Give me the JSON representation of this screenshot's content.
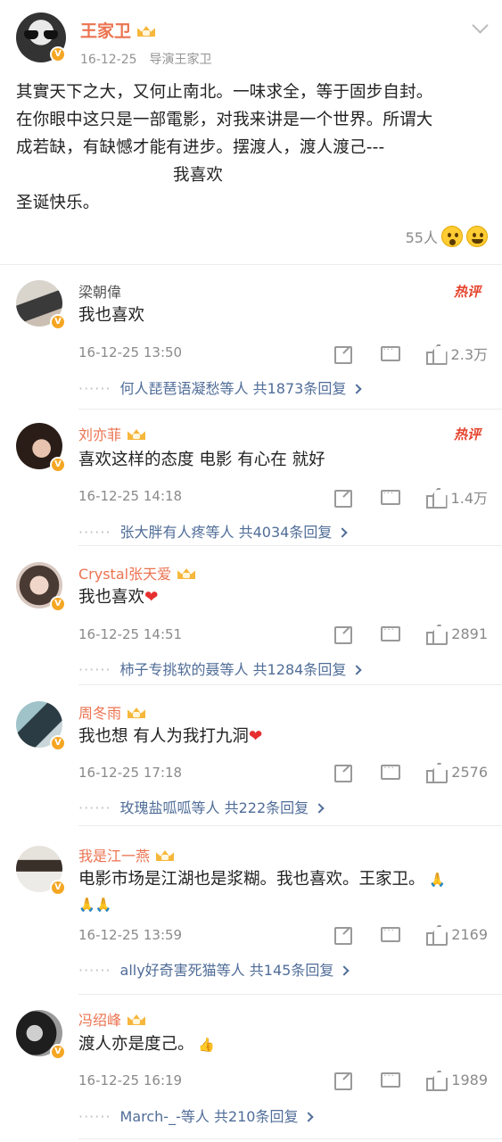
{
  "post": {
    "author": "王家卫",
    "date": "16-12-25",
    "source": "导演王家卫",
    "lines": [
      "其實天下之大，又何止南北。一味求全，等于固步自封。",
      "在你眼中这只是一部電影，对我来讲是一个世界。所谓大",
      "成若缺，有缺憾才能有进步。摆渡人，渡人渡己---",
      "我喜欢",
      "圣诞快乐。"
    ],
    "likes": "55人"
  },
  "comments": [
    {
      "name": "梁朝偉",
      "text": "我也喜欢",
      "time": "16-12-25 13:50",
      "hot": "热评",
      "likes": "2.3万",
      "reply_users": "何人琵琶语凝愁等人",
      "reply_count": "共1873条回复"
    },
    {
      "name": "刘亦菲",
      "text": "喜欢这样的态度 电影 有心在 就好",
      "time": "16-12-25 14:18",
      "hot": "热评",
      "likes": "1.4万",
      "reply_users": "张大胖有人疼等人",
      "reply_count": "共4034条回复"
    },
    {
      "name": "Crystal张天爱",
      "text": "我也喜欢",
      "time": "16-12-25 14:51",
      "hot": "",
      "likes": "2891",
      "reply_users": "柿子专挑软的聂等人",
      "reply_count": "共1284条回复"
    },
    {
      "name": "周冬雨",
      "text": "我也想 有人为我打九洞",
      "time": "16-12-25 17:18",
      "hot": "",
      "likes": "2576",
      "reply_users": "玫瑰盐呱呱等人",
      "reply_count": "共222条回复"
    },
    {
      "name": "我是江一燕",
      "text": "电影市场是江湖也是浆糊。我也喜欢。王家卫。",
      "time": "16-12-25 13:59",
      "hot": "",
      "likes": "2169",
      "reply_users": "ally好奇害死猫等人",
      "reply_count": "共145条回复"
    },
    {
      "name": "冯绍峰",
      "text": "渡人亦是度己。",
      "time": "16-12-25 16:19",
      "hot": "",
      "likes": "1989",
      "reply_users": "March-_-等人",
      "reply_count": "共210条回复"
    }
  ],
  "colors": {
    "accent_name": "#eb7350",
    "link": "#506d98",
    "muted": "#8a8a8a",
    "hot": "#e5452f"
  }
}
